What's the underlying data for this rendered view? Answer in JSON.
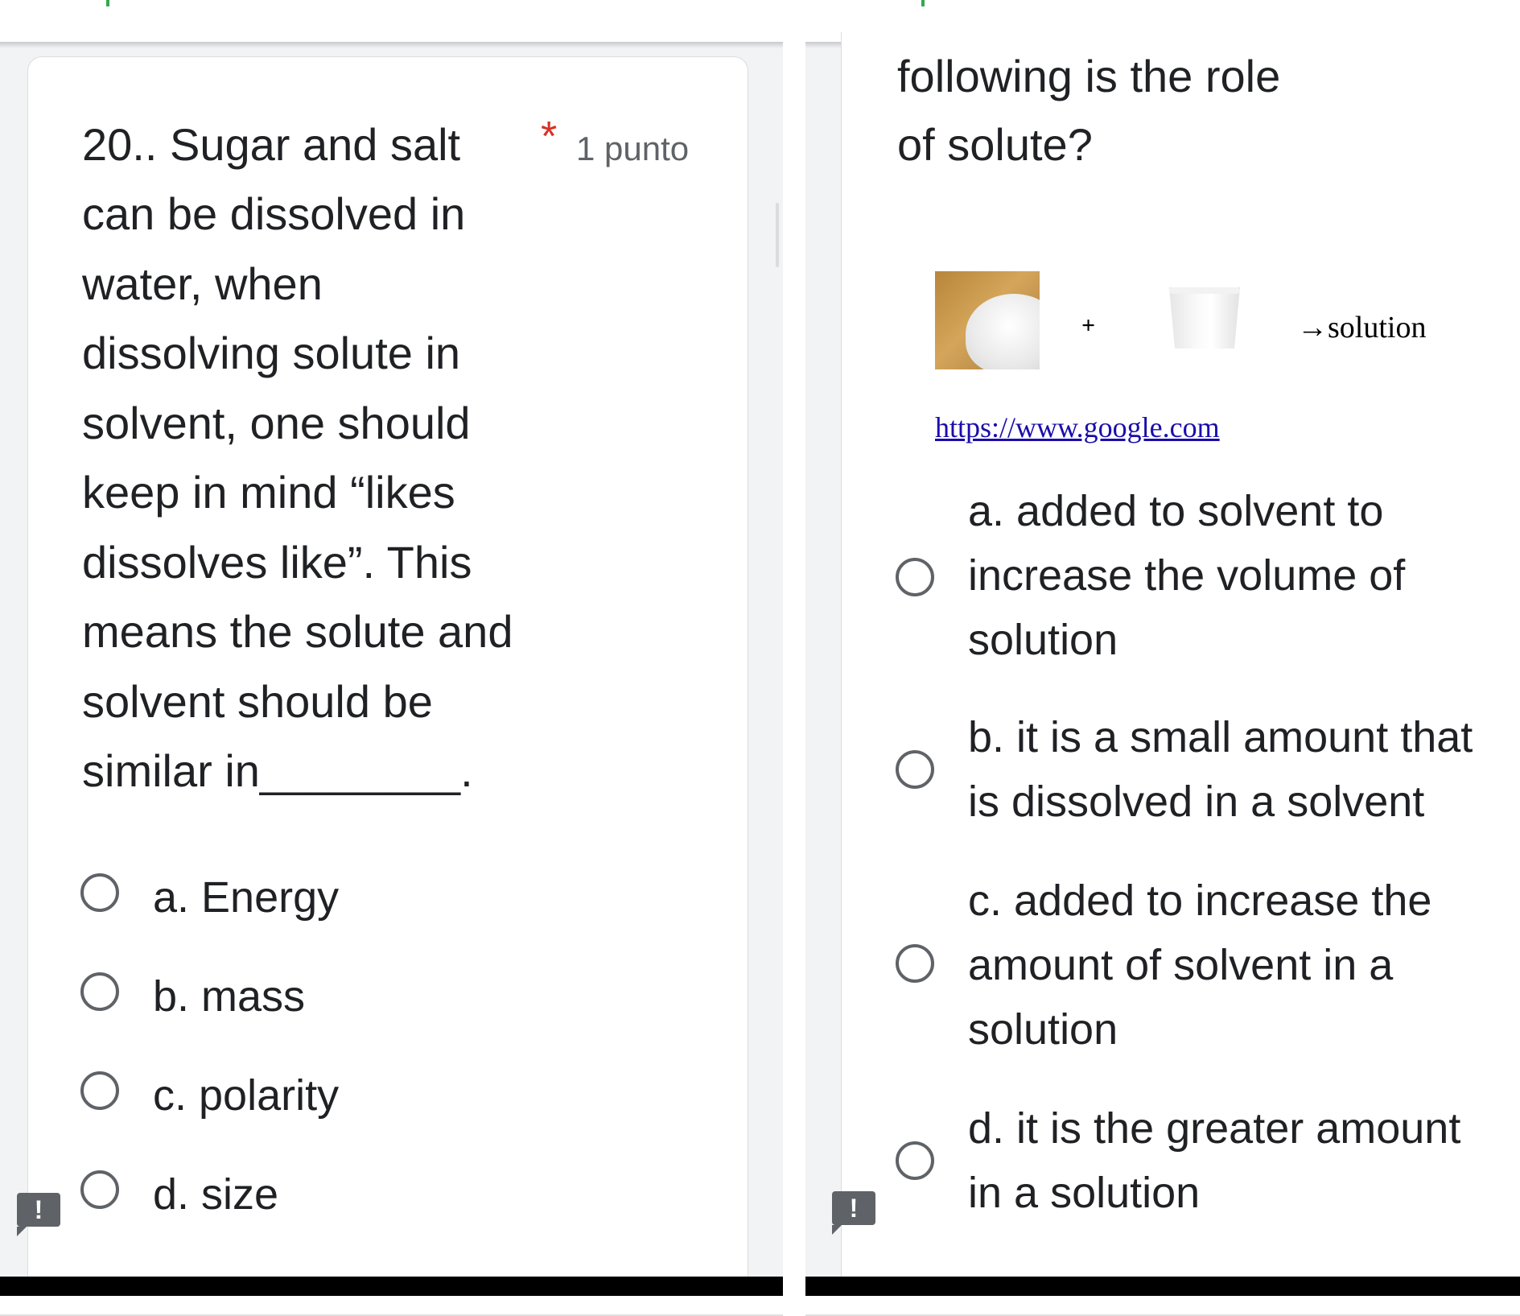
{
  "left": {
    "question_lines": [
      "20.. Sugar and salt",
      "can be dissolved in",
      "water, when",
      "dissolving solute in",
      "solvent, one should",
      "keep in mind “likes",
      "dissolves like”. This",
      "means the solute and",
      "solvent should be",
      "similar  in________."
    ],
    "required_mark": "*",
    "points_label": "1 punto",
    "options": [
      {
        "label": "a. Energy"
      },
      {
        "label": "b. mass"
      },
      {
        "label": "c. polarity"
      },
      {
        "label": "d. size"
      }
    ],
    "alert_glyph": "!"
  },
  "right": {
    "question_lines": [
      "following is the role",
      "of solute?"
    ],
    "equation": {
      "plus": "+",
      "result": "→solution"
    },
    "image_link": "https://www.google.com",
    "options": [
      {
        "lines": [
          "a.  added to solvent to",
          "increase the volume of",
          "solution"
        ]
      },
      {
        "lines": [
          "b.  it is a small amount that",
          "is dissolved in a solvent"
        ]
      },
      {
        "lines": [
          "c.  added to increase the",
          "amount of solvent in a",
          "solution"
        ]
      },
      {
        "lines": [
          "d.  it is the greater amount",
          "in a solution"
        ]
      }
    ],
    "alert_glyph": "!"
  },
  "colors": {
    "accent_green": "#34a853",
    "required_red": "#d93025",
    "background_gray": "#f1f3f4",
    "radio_gray": "#5f6368",
    "link_blue": "#1a0dab"
  },
  "icons": {
    "radio": "radio-button-unchecked-icon",
    "alert": "report-problem-icon"
  }
}
